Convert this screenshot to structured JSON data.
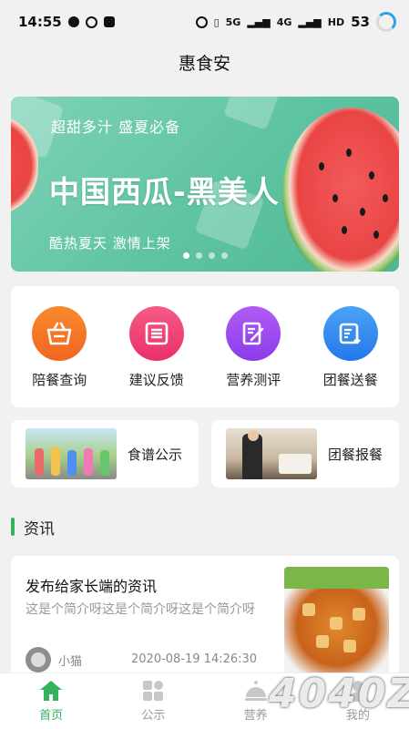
{
  "status_bar": {
    "time": "14:55",
    "battery": "53",
    "net_a": "5G",
    "net_b": "4G",
    "hd": "HD"
  },
  "app_title": "惠食安",
  "banner": {
    "subtitle": "超甜多汁 盛夏必备",
    "title": "中国西瓜-黑美人",
    "tagline": "酷热夏天  激情上架",
    "dot_count": 4,
    "active_dot": 0
  },
  "quick_actions": [
    {
      "label": "陪餐查询",
      "icon": "basket-icon",
      "color": "#f47a2a"
    },
    {
      "label": "建议反馈",
      "icon": "feedback-icon",
      "color": "#ef3f7a"
    },
    {
      "label": "营养测评",
      "icon": "evaluation-icon",
      "color": "#9a4cf0"
    },
    {
      "label": "团餐送餐",
      "icon": "delivery-icon",
      "color": "#2f8ef3"
    }
  ],
  "entries": [
    {
      "label": "食谱公示",
      "image": "children-photo"
    },
    {
      "label": "团餐报餐",
      "image": "waiter-photo"
    }
  ],
  "section_title": "资讯",
  "news": {
    "title": "发布给家长端的资讯",
    "desc": "这是个简介呀这是个简介呀这是个简介呀",
    "author": "小猫",
    "time": "2020-08-19 14:26:30",
    "thumb": "food-photo"
  },
  "tabs": [
    {
      "label": "首页",
      "icon": "home-icon",
      "active": true
    },
    {
      "label": "公示",
      "icon": "grid-icon",
      "active": false
    },
    {
      "label": "营养",
      "icon": "dish-icon",
      "active": false
    },
    {
      "label": "我的",
      "icon": "person-icon",
      "active": false
    }
  ],
  "watermark": "4040Z",
  "colors": {
    "accent": "#35b35c",
    "banner_bg": "#5ec3a2"
  }
}
